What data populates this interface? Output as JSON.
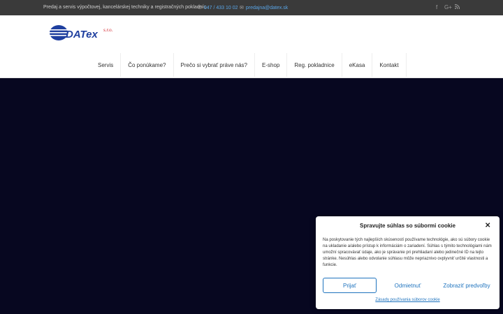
{
  "topbar": {
    "tagline": "Predaj a servis výpočtovej, kancelárskej techniky a registračných pokladníc",
    "phone": "047 / 433 10 02",
    "email": "predajna@datex.sk",
    "social": [
      "facebook-icon",
      "google-plus-icon",
      "rss-icon"
    ]
  },
  "logo": {
    "text": "DATex",
    "suffix": "s.r.o."
  },
  "nav": {
    "items": [
      {
        "label": "Servis"
      },
      {
        "label": "Čo ponúkame?"
      },
      {
        "label": "Prečo si vybrať práve nás?"
      },
      {
        "label": "E-shop"
      },
      {
        "label": "Reg. pokladnice"
      },
      {
        "label": "eKasa"
      },
      {
        "label": "Kontakt"
      }
    ]
  },
  "cookie": {
    "title": "Spravujte súhlas so súbormi cookie",
    "body": "Na poskytovanie tých najlepších skúseností používame technológie, ako sú súbory cookie na ukladanie a/alebo prístup k informáciám o zariadení. Súhlas s týmito technológiami nám umožní spracovávať údaje, ako je správanie pri prehliadaní alebo jedinečné ID na tejto stránke. Nesúhlas alebo odvolanie súhlasu môže nepriaznivo ovplyvniť určité vlastnosti a funkcie.",
    "accept_label": "Prijať",
    "deny_label": "Odmietnuť",
    "prefs_label": "Zobraziť predvoľby",
    "policy_label": "Zásady používania súborov cookie"
  },
  "colors": {
    "topbar_bg": "#3a3a3a",
    "link": "#1e73be",
    "hero_bg": "#070720",
    "logo_blue": "#1f3f9f",
    "logo_red": "#d11d25"
  }
}
